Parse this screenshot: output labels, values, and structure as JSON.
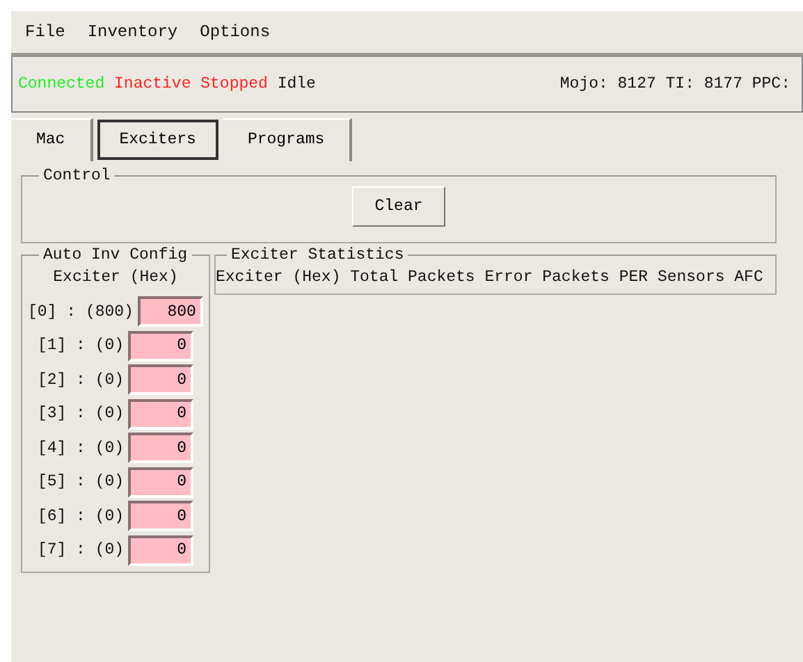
{
  "menu": [
    "File",
    "Inventory",
    "Options"
  ],
  "status": [
    {
      "label": "Connected",
      "color": "#22ee22"
    },
    {
      "label": "Inactive",
      "color": "#ff2222"
    },
    {
      "label": "Stopped",
      "color": "#ff2222"
    },
    {
      "label": "Idle",
      "color": "#111111"
    }
  ],
  "status_info": "Mojo: 8127 TI: 8177 PPC:",
  "tabs": [
    {
      "label": "Mac",
      "selected": false
    },
    {
      "label": "Exciters",
      "selected": true
    },
    {
      "label": "Programs",
      "selected": false
    }
  ],
  "control": {
    "title": "Control",
    "buttons": [
      "Clear"
    ]
  },
  "auto_inv_config": {
    "title": "Auto Inv Config",
    "header": "Exciter (Hex)",
    "rows": [
      {
        "label": "[0] : (800)",
        "value": "800"
      },
      {
        "label": "[1] : (0)",
        "value": "0"
      },
      {
        "label": "[2] : (0)",
        "value": "0"
      },
      {
        "label": "[3] : (0)",
        "value": "0"
      },
      {
        "label": "[4] : (0)",
        "value": "0"
      },
      {
        "label": "[5] : (0)",
        "value": "0"
      },
      {
        "label": "[6] : (0)",
        "value": "0"
      },
      {
        "label": "[7] : (0)",
        "value": "0"
      }
    ]
  },
  "exciter_statistics": {
    "title": "Exciter Statistics",
    "columns": [
      "Exciter (Hex)",
      "Total Packets",
      "Error Packets",
      "PER",
      "Sensors",
      "AFC"
    ]
  }
}
